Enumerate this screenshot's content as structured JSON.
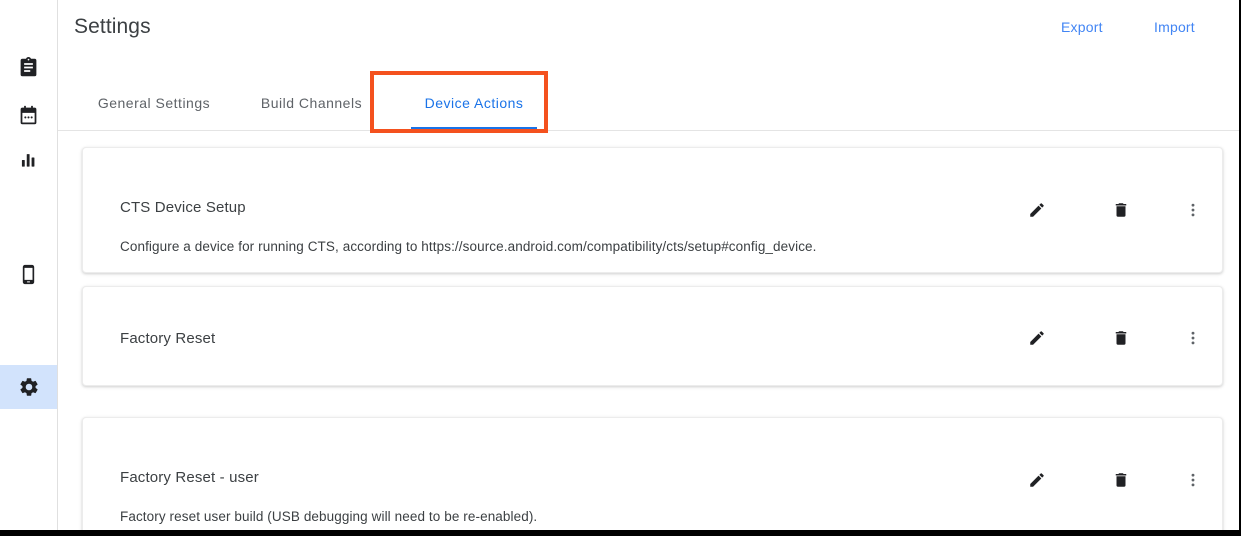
{
  "header": {
    "title": "Settings",
    "export_label": "Export",
    "import_label": "Import"
  },
  "sidebar": {
    "items": [
      {
        "name": "clipboard",
        "icon": "clipboard-icon",
        "active": false
      },
      {
        "name": "calendar",
        "icon": "calendar-icon",
        "active": false
      },
      {
        "name": "analytics",
        "icon": "bar-chart-icon",
        "active": false
      },
      {
        "name": "devices",
        "icon": "phone-icon",
        "active": false
      },
      {
        "name": "settings",
        "icon": "gear-icon",
        "active": true
      }
    ]
  },
  "tabs": [
    {
      "label": "General Settings",
      "active": false
    },
    {
      "label": "Build Channels",
      "active": false
    },
    {
      "label": "Device Actions",
      "active": true
    }
  ],
  "annotation": {
    "target": "Device Actions",
    "color": "#f4511e"
  },
  "colors": {
    "accent_blue": "#1a73e8",
    "link_blue": "#4285f4",
    "sidebar_active_bg": "#d2e3fc",
    "annotation": "#f4511e",
    "text_primary": "#3c4043",
    "text_secondary": "#5f6368"
  },
  "device_actions": [
    {
      "title": "CTS Device Setup",
      "description": "Configure a device for running CTS, according to https://source.android.com/compatibility/cts/setup#config_device.",
      "edit_label": "edit-icon",
      "delete_label": "delete-icon",
      "more_label": "more-vert-icon"
    },
    {
      "title": "Factory Reset",
      "description": "",
      "edit_label": "edit-icon",
      "delete_label": "delete-icon",
      "more_label": "more-vert-icon"
    },
    {
      "title": "Factory Reset - user",
      "description": "Factory reset user build (USB debugging will need to be re-enabled).",
      "edit_label": "edit-icon",
      "delete_label": "delete-icon",
      "more_label": "more-vert-icon"
    }
  ]
}
